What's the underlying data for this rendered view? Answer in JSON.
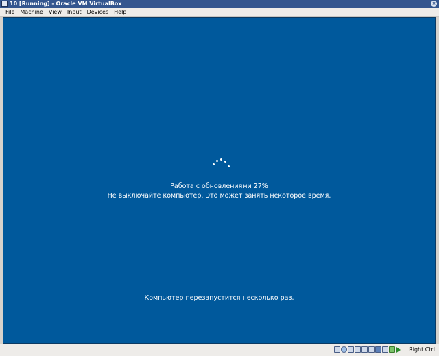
{
  "window": {
    "title": "10 [Running] - Oracle VM VirtualBox"
  },
  "menu": {
    "items": [
      "File",
      "Machine",
      "View",
      "Input",
      "Devices",
      "Help"
    ]
  },
  "vm": {
    "progress_line": "Работа с обновлениями  27%",
    "progress_percent": 27,
    "warning_line": "Не выключайте компьютер. Это может занять некоторое время.",
    "restart_line": "Компьютер перезапустится несколько раз.",
    "background_color": "#00599c"
  },
  "statusbar": {
    "icons": [
      "hard-disk-icon",
      "optical-disk-icon",
      "audio-icon",
      "network-icon",
      "usb-icon",
      "shared-folders-icon",
      "display-icon",
      "video-capture-icon",
      "virtualization-icon",
      "arrow-icon"
    ],
    "host_key": "Right Ctrl"
  }
}
